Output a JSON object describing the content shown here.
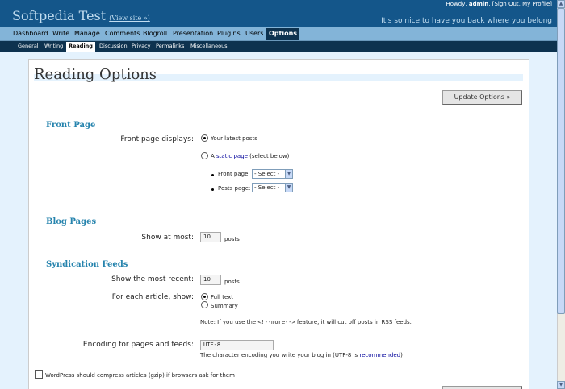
{
  "header": {
    "site_title": "Softpedia Test",
    "view_site": "(View site »)",
    "user_prefix": "Howdy, ",
    "user_name": "admin",
    "user_links": ". [Sign Out, My Profile]",
    "welcome": "It's so nice to have you back where you belong"
  },
  "menu": {
    "items": [
      "Dashboard",
      "Write",
      "Manage",
      "Comments",
      "Blogroll",
      "Presentation",
      "Plugins",
      "Users",
      "Options"
    ],
    "current": "Options"
  },
  "submenu": {
    "items": [
      "General",
      "Writing",
      "Reading",
      "Discussion",
      "Privacy",
      "Permalinks",
      "Miscellaneous"
    ],
    "current": "Reading"
  },
  "page": {
    "title": "Reading Options",
    "update_button": "Update Options »"
  },
  "front_page": {
    "heading": "Front Page",
    "label": "Front page displays:",
    "option_latest": "Your latest posts",
    "option_static_prefix": "A ",
    "option_static_link": "static page",
    "option_static_suffix": " (select below)",
    "selected": "latest",
    "front_label": "Front page:",
    "front_value": "- Select -",
    "posts_label": "Posts page:",
    "posts_value": "- Select -"
  },
  "blog_pages": {
    "heading": "Blog Pages",
    "label": "Show at most:",
    "value": "10",
    "unit": "posts"
  },
  "syndication": {
    "heading": "Syndication Feeds",
    "recent_label": "Show the most recent:",
    "recent_value": "10",
    "recent_unit": "posts",
    "article_label": "For each article, show:",
    "option_full": "Full text",
    "option_summary": "Summary",
    "selected": "full",
    "note_prefix": "Note: If you use the ",
    "note_code": "<!--more-->",
    "note_suffix": " feature, it will cut off posts in RSS feeds.",
    "encoding_label": "Encoding for pages and feeds:",
    "encoding_value": "UTF-8",
    "encoding_help_prefix": "The character encoding you write your blog in (UTF-8 is ",
    "encoding_help_link": "recommended",
    "encoding_help_suffix": ")"
  },
  "gzip": {
    "label": "WordPress should compress articles (gzip) if browsers ask for them",
    "checked": false
  },
  "colors": {
    "header_bg": "#14568a",
    "menu_bg": "#83b4d8",
    "submenu_bg": "#0d324f",
    "heading": "#2583ad",
    "page_bg": "#e4f2fd"
  },
  "icons": [
    "scroll-up-arrow-icon",
    "scroll-down-arrow-icon",
    "select-dropdown-arrow-icon"
  ]
}
